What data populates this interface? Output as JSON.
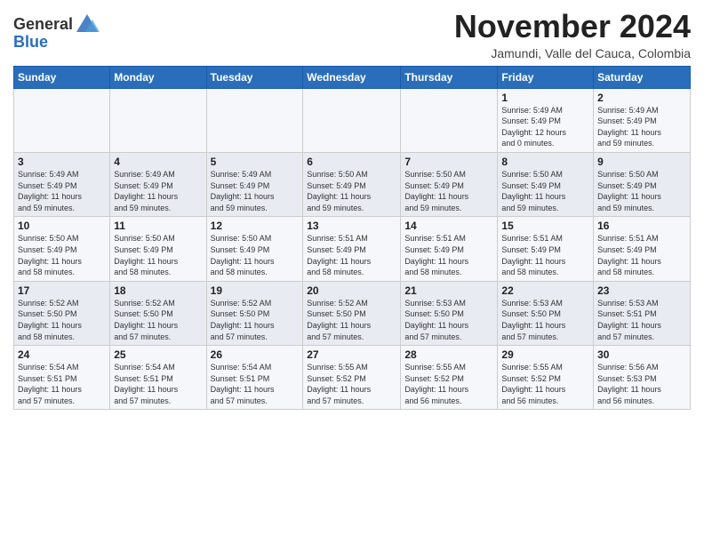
{
  "header": {
    "logo_general": "General",
    "logo_blue": "Blue",
    "month": "November 2024",
    "location": "Jamundi, Valle del Cauca, Colombia"
  },
  "days_of_week": [
    "Sunday",
    "Monday",
    "Tuesday",
    "Wednesday",
    "Thursday",
    "Friday",
    "Saturday"
  ],
  "weeks": [
    [
      {
        "day": "",
        "info": ""
      },
      {
        "day": "",
        "info": ""
      },
      {
        "day": "",
        "info": ""
      },
      {
        "day": "",
        "info": ""
      },
      {
        "day": "",
        "info": ""
      },
      {
        "day": "1",
        "info": "Sunrise: 5:49 AM\nSunset: 5:49 PM\nDaylight: 12 hours\nand 0 minutes."
      },
      {
        "day": "2",
        "info": "Sunrise: 5:49 AM\nSunset: 5:49 PM\nDaylight: 11 hours\nand 59 minutes."
      }
    ],
    [
      {
        "day": "3",
        "info": "Sunrise: 5:49 AM\nSunset: 5:49 PM\nDaylight: 11 hours\nand 59 minutes."
      },
      {
        "day": "4",
        "info": "Sunrise: 5:49 AM\nSunset: 5:49 PM\nDaylight: 11 hours\nand 59 minutes."
      },
      {
        "day": "5",
        "info": "Sunrise: 5:49 AM\nSunset: 5:49 PM\nDaylight: 11 hours\nand 59 minutes."
      },
      {
        "day": "6",
        "info": "Sunrise: 5:50 AM\nSunset: 5:49 PM\nDaylight: 11 hours\nand 59 minutes."
      },
      {
        "day": "7",
        "info": "Sunrise: 5:50 AM\nSunset: 5:49 PM\nDaylight: 11 hours\nand 59 minutes."
      },
      {
        "day": "8",
        "info": "Sunrise: 5:50 AM\nSunset: 5:49 PM\nDaylight: 11 hours\nand 59 minutes."
      },
      {
        "day": "9",
        "info": "Sunrise: 5:50 AM\nSunset: 5:49 PM\nDaylight: 11 hours\nand 59 minutes."
      }
    ],
    [
      {
        "day": "10",
        "info": "Sunrise: 5:50 AM\nSunset: 5:49 PM\nDaylight: 11 hours\nand 58 minutes."
      },
      {
        "day": "11",
        "info": "Sunrise: 5:50 AM\nSunset: 5:49 PM\nDaylight: 11 hours\nand 58 minutes."
      },
      {
        "day": "12",
        "info": "Sunrise: 5:50 AM\nSunset: 5:49 PM\nDaylight: 11 hours\nand 58 minutes."
      },
      {
        "day": "13",
        "info": "Sunrise: 5:51 AM\nSunset: 5:49 PM\nDaylight: 11 hours\nand 58 minutes."
      },
      {
        "day": "14",
        "info": "Sunrise: 5:51 AM\nSunset: 5:49 PM\nDaylight: 11 hours\nand 58 minutes."
      },
      {
        "day": "15",
        "info": "Sunrise: 5:51 AM\nSunset: 5:49 PM\nDaylight: 11 hours\nand 58 minutes."
      },
      {
        "day": "16",
        "info": "Sunrise: 5:51 AM\nSunset: 5:49 PM\nDaylight: 11 hours\nand 58 minutes."
      }
    ],
    [
      {
        "day": "17",
        "info": "Sunrise: 5:52 AM\nSunset: 5:50 PM\nDaylight: 11 hours\nand 58 minutes."
      },
      {
        "day": "18",
        "info": "Sunrise: 5:52 AM\nSunset: 5:50 PM\nDaylight: 11 hours\nand 57 minutes."
      },
      {
        "day": "19",
        "info": "Sunrise: 5:52 AM\nSunset: 5:50 PM\nDaylight: 11 hours\nand 57 minutes."
      },
      {
        "day": "20",
        "info": "Sunrise: 5:52 AM\nSunset: 5:50 PM\nDaylight: 11 hours\nand 57 minutes."
      },
      {
        "day": "21",
        "info": "Sunrise: 5:53 AM\nSunset: 5:50 PM\nDaylight: 11 hours\nand 57 minutes."
      },
      {
        "day": "22",
        "info": "Sunrise: 5:53 AM\nSunset: 5:50 PM\nDaylight: 11 hours\nand 57 minutes."
      },
      {
        "day": "23",
        "info": "Sunrise: 5:53 AM\nSunset: 5:51 PM\nDaylight: 11 hours\nand 57 minutes."
      }
    ],
    [
      {
        "day": "24",
        "info": "Sunrise: 5:54 AM\nSunset: 5:51 PM\nDaylight: 11 hours\nand 57 minutes."
      },
      {
        "day": "25",
        "info": "Sunrise: 5:54 AM\nSunset: 5:51 PM\nDaylight: 11 hours\nand 57 minutes."
      },
      {
        "day": "26",
        "info": "Sunrise: 5:54 AM\nSunset: 5:51 PM\nDaylight: 11 hours\nand 57 minutes."
      },
      {
        "day": "27",
        "info": "Sunrise: 5:55 AM\nSunset: 5:52 PM\nDaylight: 11 hours\nand 57 minutes."
      },
      {
        "day": "28",
        "info": "Sunrise: 5:55 AM\nSunset: 5:52 PM\nDaylight: 11 hours\nand 56 minutes."
      },
      {
        "day": "29",
        "info": "Sunrise: 5:55 AM\nSunset: 5:52 PM\nDaylight: 11 hours\nand 56 minutes."
      },
      {
        "day": "30",
        "info": "Sunrise: 5:56 AM\nSunset: 5:53 PM\nDaylight: 11 hours\nand 56 minutes."
      }
    ]
  ]
}
